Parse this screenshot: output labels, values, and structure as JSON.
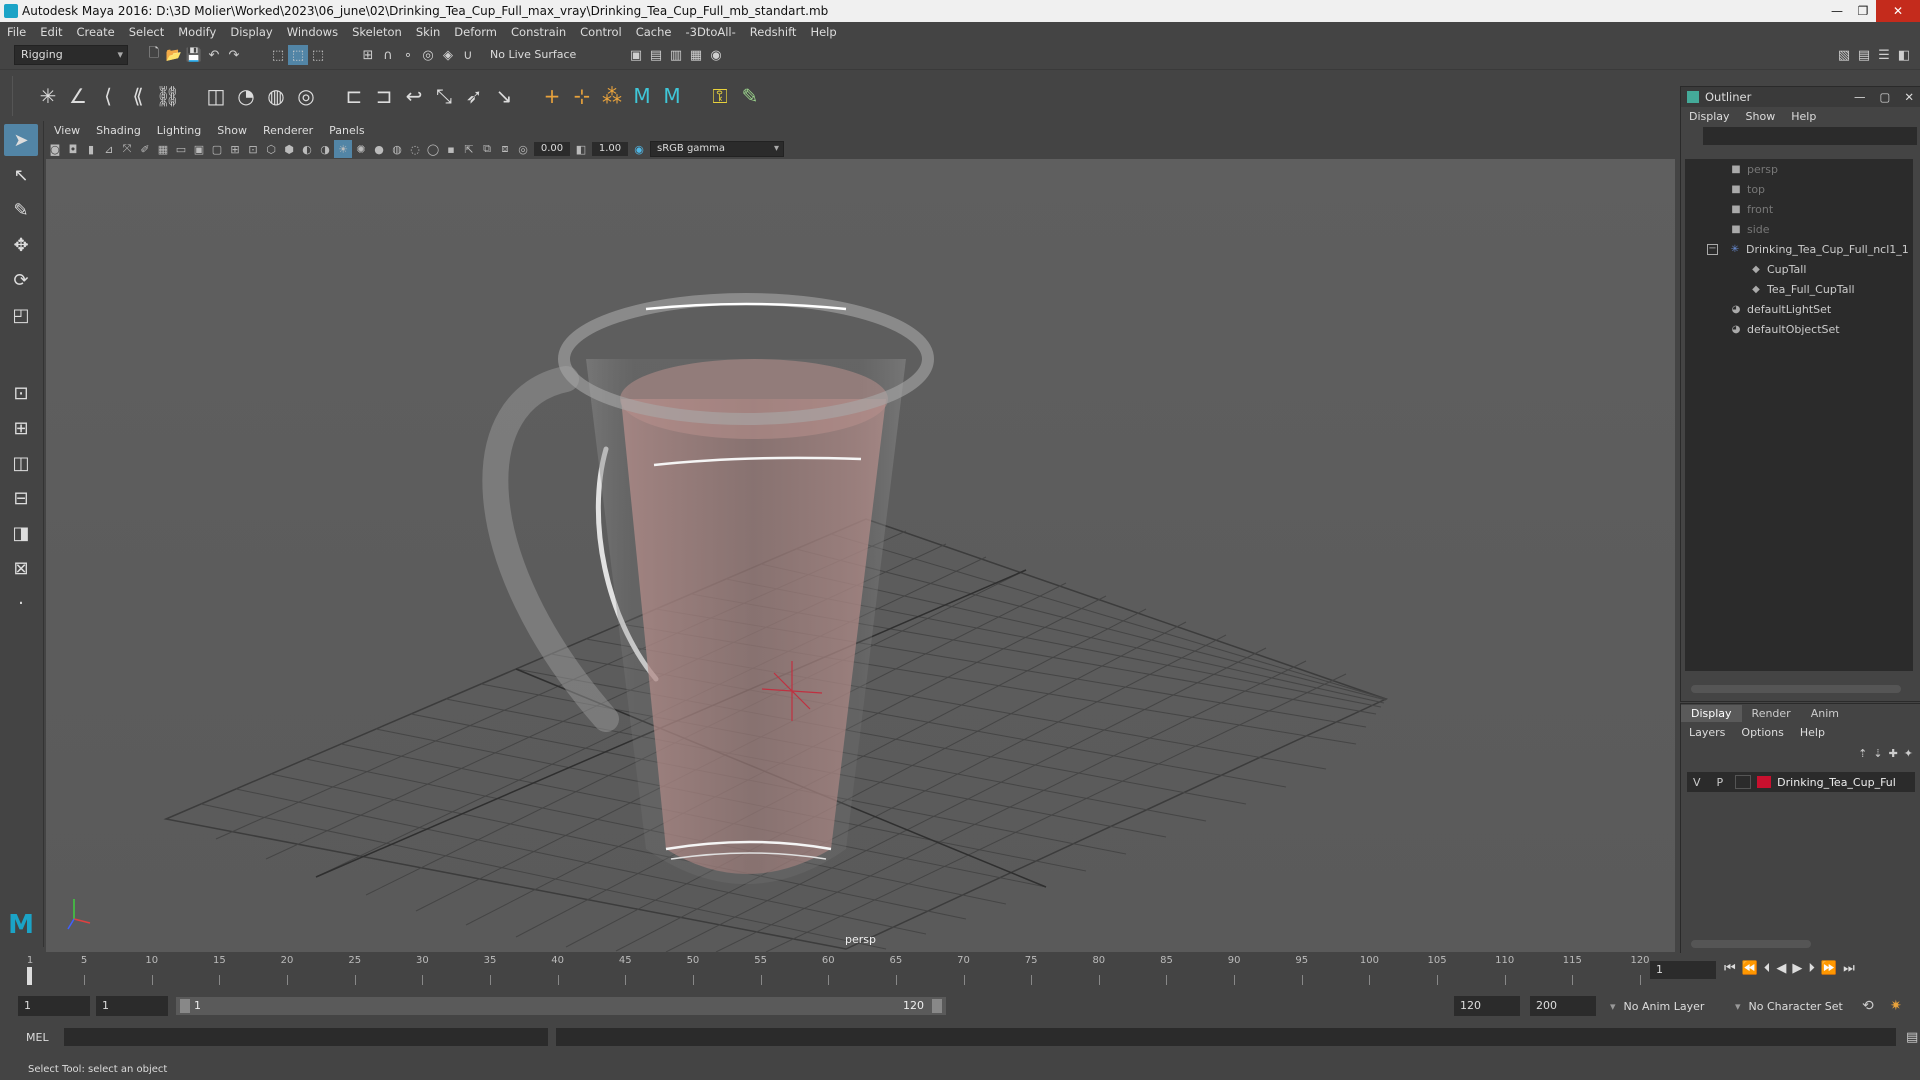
{
  "title_bar": {
    "title": "Autodesk Maya 2016: D:\\3D Molier\\Worked\\2023\\06_june\\02\\Drinking_Tea_Cup_Full_max_vray\\Drinking_Tea_Cup_Full_mb_standart.mb",
    "minimize": "—",
    "maximize": "❐",
    "close": "✕"
  },
  "menubar": {
    "items": [
      "File",
      "Edit",
      "Create",
      "Select",
      "Modify",
      "Display",
      "Windows",
      "Skeleton",
      "Skin",
      "Deform",
      "Constrain",
      "Control",
      "Cache",
      "-3DtoAll-",
      "Redshift",
      "Help"
    ]
  },
  "statusline": {
    "menuset": "Rigging",
    "live_surface": "No Live Surface"
  },
  "panel": {
    "menu": [
      "View",
      "Shading",
      "Lighting",
      "Show",
      "Renderer",
      "Panels"
    ],
    "exposure": "0.00",
    "gamma": "1.00",
    "color_space": "sRGB gamma",
    "camera_label": "persp"
  },
  "outliner": {
    "title": "Outliner",
    "menu": [
      "Display",
      "Show",
      "Help"
    ],
    "items": [
      {
        "label": "persp",
        "icon": "camera-icon",
        "dim": true
      },
      {
        "label": "top",
        "icon": "camera-icon",
        "dim": true
      },
      {
        "label": "front",
        "icon": "camera-icon",
        "dim": true
      },
      {
        "label": "side",
        "icon": "camera-icon",
        "dim": true
      },
      {
        "label": "Drinking_Tea_Cup_Full_ncl1_1",
        "icon": "group-icon",
        "dim": false
      },
      {
        "label": "CupTall",
        "icon": "mesh-icon",
        "dim": false
      },
      {
        "label": "Tea_Full_CupTall",
        "icon": "mesh-icon",
        "dim": false
      },
      {
        "label": "defaultLightSet",
        "icon": "set-icon",
        "dim": false
      },
      {
        "label": "defaultObjectSet",
        "icon": "set-icon",
        "dim": false
      }
    ]
  },
  "layer_editor": {
    "tabs": [
      "Display",
      "Render",
      "Anim"
    ],
    "menu": [
      "Layers",
      "Options",
      "Help"
    ],
    "layer": {
      "v": "V",
      "p": "P",
      "name": "Drinking_Tea_Cup_Ful",
      "color": "#c8102e"
    }
  },
  "timeline": {
    "ticks": [
      1,
      5,
      10,
      15,
      20,
      25,
      30,
      35,
      40,
      45,
      50,
      55,
      60,
      65,
      70,
      75,
      80,
      85,
      90,
      95,
      100,
      105,
      110,
      115,
      120
    ],
    "current_frame": "1"
  },
  "range": {
    "start": "1",
    "current": "1",
    "range_start_label": "1",
    "range_end_label": "120",
    "end": "120",
    "max": "200",
    "anim_layer": "No Anim Layer",
    "char_set": "No Character Set"
  },
  "cmdline": {
    "label": "MEL"
  },
  "helpline": {
    "text": "Select Tool: select an object"
  }
}
